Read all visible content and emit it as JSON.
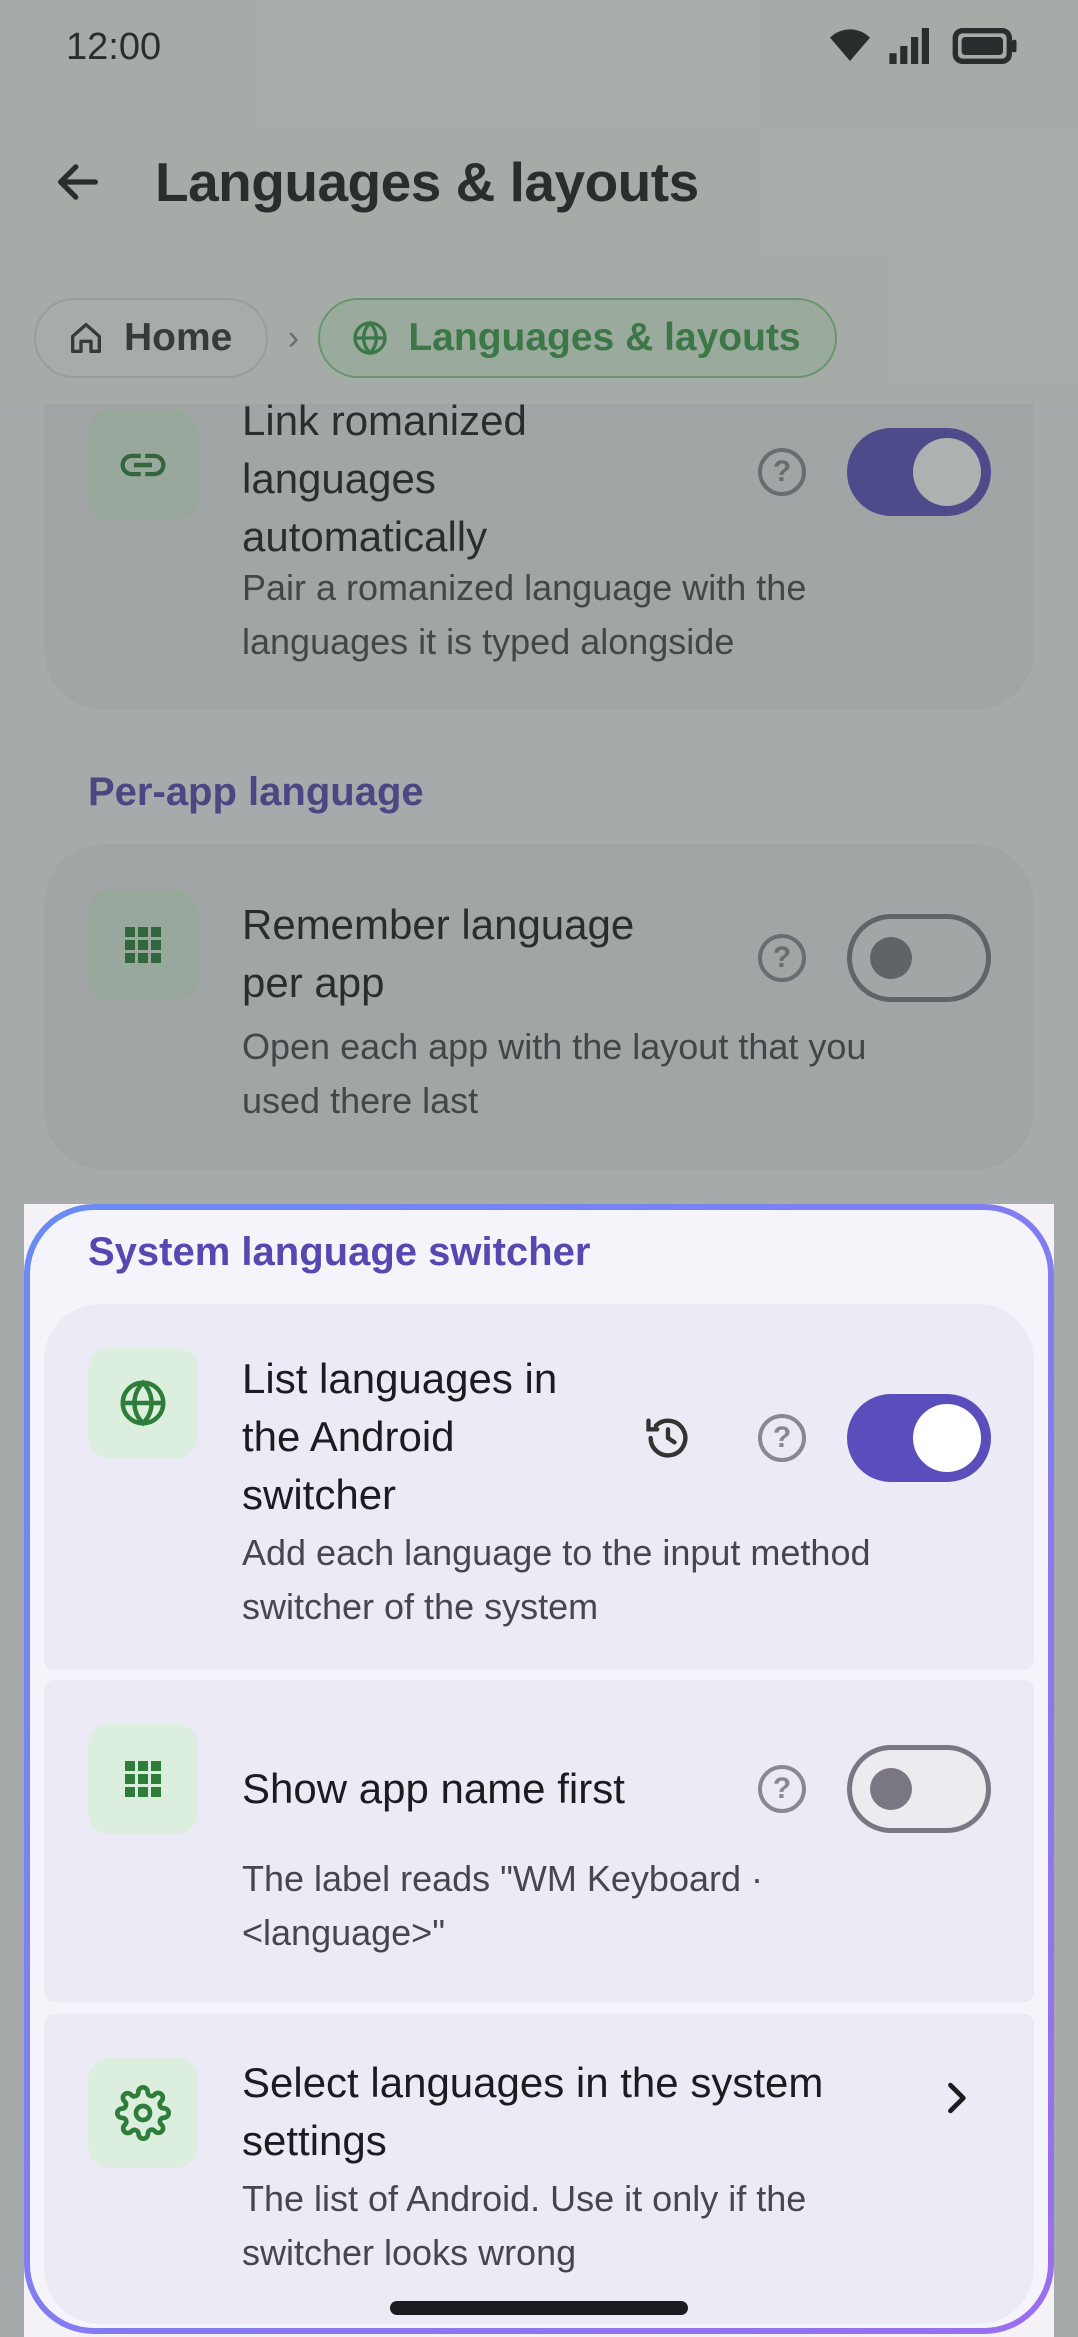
{
  "status_bar": {
    "time": "12:00"
  },
  "header": {
    "title": "Languages & layouts"
  },
  "breadcrumb": {
    "home": "Home",
    "separator": "›",
    "current": "Languages & layouts"
  },
  "cards": {
    "link_romanized": {
      "title_lines": [
        "Link romanized",
        "languages",
        "automatically"
      ],
      "desc_lines": [
        "Pair a romanized language with the",
        "languages it is typed alongside"
      ],
      "enabled": true
    },
    "per_app_section": "Per-app language",
    "remember_per_app": {
      "title_lines": [
        "Remember language",
        "per app"
      ],
      "desc_lines": [
        "Open each app with the layout that you",
        "used there last"
      ],
      "enabled": false
    },
    "system_switcher_section": "System language switcher",
    "list_in_switcher": {
      "title_lines": [
        "List languages in",
        "the Android",
        "switcher"
      ],
      "desc_lines": [
        "Add each language to the input method",
        "switcher of the system"
      ],
      "enabled": true
    },
    "app_name_first": {
      "title": "Show app name first",
      "desc_lines": [
        "The label reads \"WM Keyboard ·",
        "<language>\""
      ],
      "enabled": false
    },
    "system_settings": {
      "title_lines": [
        "Select languages in the system",
        "settings"
      ],
      "desc_lines": [
        "The list of Android. Use it only if the",
        "switcher looks wrong"
      ]
    }
  },
  "help_glyph": "?",
  "colors": {
    "accent": "#5a4ebd",
    "section_heading": "#5548b0",
    "icon_green": "#2e7d3a",
    "highlight_border_start": "#6a8cf2",
    "highlight_border_end": "#9a6ef0"
  }
}
